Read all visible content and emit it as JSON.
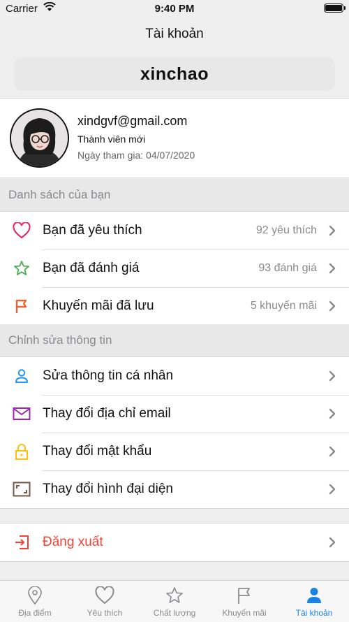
{
  "status_bar": {
    "carrier": "Carrier",
    "time": "9:40 PM"
  },
  "nav": {
    "title": "Tài khoản"
  },
  "profile": {
    "username": "xinchao",
    "email": "xindgvf@gmail.com",
    "member_level": "Thành viên mới",
    "joined": "Ngày tham gia: 04/07/2020"
  },
  "sections": {
    "list_header": "Danh sách của bạn",
    "edit_header": "Chỉnh sửa thông tin"
  },
  "list_rows": [
    {
      "label": "Bạn đã yêu thích",
      "value": "92 yêu thích",
      "icon": "heart-icon",
      "color": "#e91e63"
    },
    {
      "label": "Bạn đã đánh giá",
      "value": "93 đánh giá",
      "icon": "star-icon",
      "color": "#4caf50"
    },
    {
      "label": "Khuyến mãi đã lưu",
      "value": "5 khuyến mãi",
      "icon": "flag-icon",
      "color": "#ff5722"
    }
  ],
  "edit_rows": [
    {
      "label": "Sửa thông tin cá nhân",
      "icon": "person-icon",
      "color": "#2196f3"
    },
    {
      "label": "Thay đổi địa chỉ email",
      "icon": "mail-icon",
      "color": "#9c27b0"
    },
    {
      "label": "Thay đổi mật khẩu",
      "icon": "lock-icon",
      "color": "#ffc107"
    },
    {
      "label": "Thay đổi hình đại diện",
      "icon": "image-frame-icon",
      "color": "#795548"
    }
  ],
  "logout": {
    "label": "Đăng xuất",
    "icon": "logout-icon",
    "color": "#f44336"
  },
  "tabs": [
    {
      "label": "Địa điểm",
      "icon": "location-pin-icon"
    },
    {
      "label": "Yêu thích",
      "icon": "heart-icon"
    },
    {
      "label": "Chất lượng",
      "icon": "star-icon"
    },
    {
      "label": "Khuyến mãi",
      "icon": "flag-icon"
    },
    {
      "label": "Tài khoản",
      "icon": "person-icon",
      "active": true
    }
  ],
  "colors": {
    "accent": "#1a82e6",
    "tab_inactive": "#8a8a8e",
    "logout_text": "#f44336"
  }
}
